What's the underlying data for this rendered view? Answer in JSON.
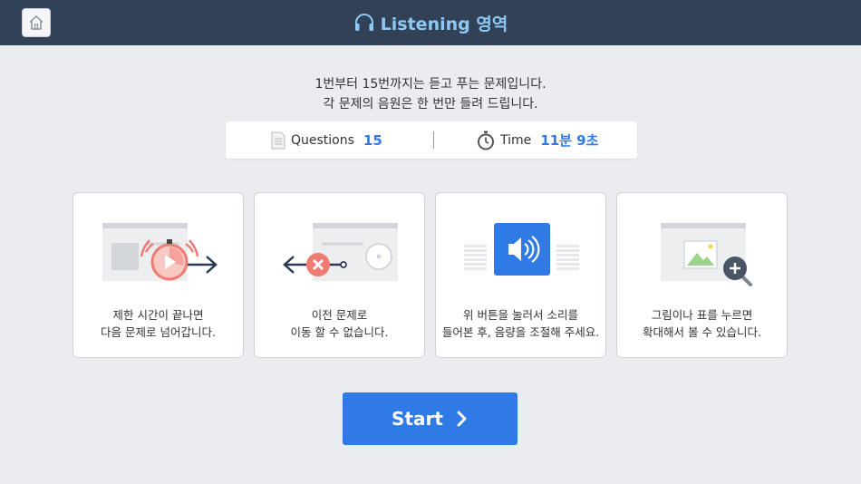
{
  "header": {
    "title": "Listening 영역",
    "icons": {
      "home": "home-icon",
      "headphones": "headphones-icon"
    }
  },
  "intro": {
    "line1": "1번부터 15번까지는 듣고 푸는 문제입니다.",
    "line2": "각 문제의 음원은 한 번만 들려 드립니다."
  },
  "info": {
    "questions_label": "Questions",
    "questions_value": "15",
    "time_label": "Time",
    "time_value": "11분 9초"
  },
  "cards": [
    {
      "line1": "제한 시간이 끝나면",
      "line2": "다음 문제로 넘어갑니다.",
      "icon": "timer-next-icon"
    },
    {
      "line1": "이전 문제로",
      "line2": "이동 할 수 없습니다.",
      "icon": "no-back-icon"
    },
    {
      "line1": "위 버튼을 눌러서 소리를",
      "line2": "들어본 후, 음량을 조절해 주세요.",
      "icon": "speaker-icon"
    },
    {
      "line1": "그림이나 표를 누르면",
      "line2": "확대해서 볼 수 있습니다.",
      "icon": "zoom-image-icon"
    }
  ],
  "start_button": {
    "label": "Start"
  },
  "colors": {
    "topbar": "#324256",
    "title": "#8ec8f5",
    "accent": "#2f7ae5",
    "background": "#eaecef",
    "alarm": "#f07b73"
  }
}
